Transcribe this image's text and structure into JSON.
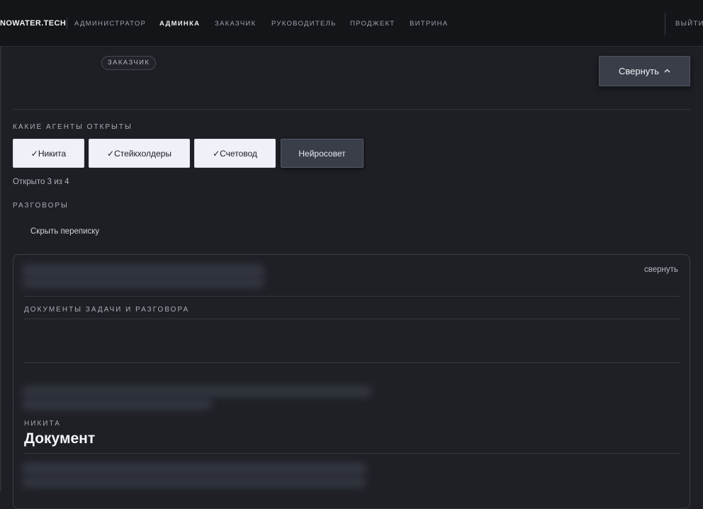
{
  "nav": {
    "brand": "NOWATER.TECH",
    "links": [
      {
        "label": "АДМИНИСТРАТОР",
        "active": false
      },
      {
        "label": "АДМИНКА",
        "active": true
      },
      {
        "label": "ЗАКАЗЧИК",
        "active": false
      },
      {
        "label": "РУКОВОДИТЕЛЬ",
        "active": false
      },
      {
        "label": "ПРОДЖЕКТ",
        "active": false
      },
      {
        "label": "ВИТРИНА",
        "active": false
      }
    ],
    "logout": "ВЫЙТИ"
  },
  "header": {
    "role_badge": "ЗАКАЗЧИК",
    "collapse_button": "Свернуть",
    "collapse_icon": "chevron-up-icon"
  },
  "agents": {
    "section_title": "КАКИЕ АГЕНТЫ ОТКРЫТЫ",
    "items": [
      {
        "label": "✓Никита",
        "enabled": true
      },
      {
        "label": "✓Стейкхолдеры",
        "enabled": true
      },
      {
        "label": "✓Счетовод",
        "enabled": true
      },
      {
        "label": "Нейросовет",
        "enabled": false
      }
    ],
    "opened_count": "Открыто 3 из 4"
  },
  "conversations": {
    "section_title": "РАЗГОВОРЫ",
    "hide_link": "Скрыть переписку",
    "panel": {
      "collapse_link": "свернуть",
      "documents_title": "ДОКУМЕНТЫ ЗАДАЧИ И РАЗГОВОРА",
      "document": {
        "owner": "НИКИТА",
        "title": "Документ"
      }
    }
  },
  "colors": {
    "background": "#1d1f25",
    "topbar": "#141519",
    "button_active_bg": "#eef1f7",
    "button_inactive_bg": "#3a3e48"
  }
}
